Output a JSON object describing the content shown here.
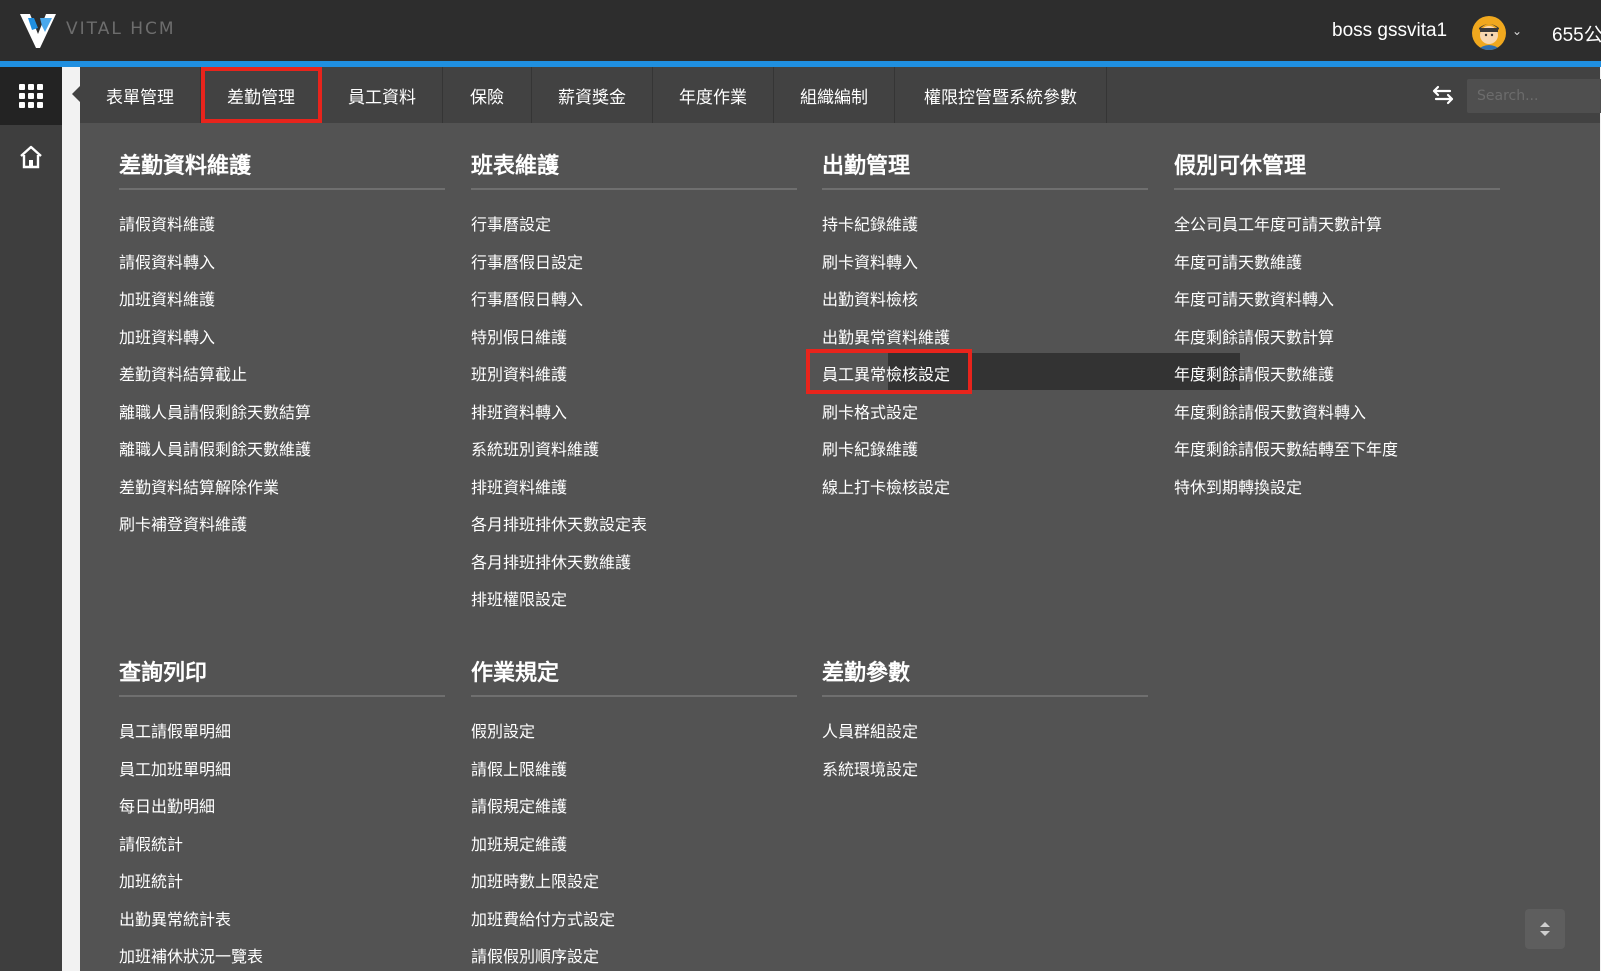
{
  "header": {
    "logo_text": "VITAL HCM",
    "user_name": "boss gssvita1",
    "right_text": "655公"
  },
  "search": {
    "placeholder": "Search..."
  },
  "tabs": [
    "表單管理",
    "差勤管理",
    "員工資料",
    "保險",
    "薪資獎金",
    "年度作業",
    "組織編制",
    "權限控管暨系統參數"
  ],
  "columns": [
    {
      "title": "差勤資料維護",
      "items": [
        "請假資料維護",
        "請假資料轉入",
        "加班資料維護",
        "加班資料轉入",
        "差勤資料結算截止",
        "離職人員請假剩餘天數結算",
        "離職人員請假剩餘天數維護",
        "差勤資料結算解除作業",
        "刷卡補登資料維護"
      ]
    },
    {
      "title": "班表維護",
      "items": [
        "行事曆設定",
        "行事曆假日設定",
        "行事曆假日轉入",
        "特別假日維護",
        "班別資料維護",
        "排班資料轉入",
        "系統班別資料維護",
        "排班資料維護",
        "各月排班排休天數設定表",
        "各月排班排休天數維護",
        "排班權限設定"
      ]
    },
    {
      "title": "出勤管理",
      "items": [
        "持卡紀錄維護",
        "刷卡資料轉入",
        "出勤資料檢核",
        "出勤異常資料維護",
        "員工異常檢核設定",
        "刷卡格式設定",
        "刷卡紀錄維護",
        "線上打卡檢核設定"
      ]
    },
    {
      "title": "假別可休管理",
      "items": [
        "全公司員工年度可請天數計算",
        "年度可請天數維護",
        "年度可請天數資料轉入",
        "年度剩餘請假天數計算",
        "年度剩餘請假天數維護",
        "年度剩餘請假天數資料轉入",
        "年度剩餘請假天數結轉至下年度",
        "特休到期轉換設定"
      ]
    },
    {
      "title": "查詢列印",
      "items": [
        "員工請假單明細",
        "員工加班單明細",
        "每日出勤明細",
        "請假統計",
        "加班統計",
        "出勤異常統計表",
        "加班補休狀況一覽表"
      ]
    },
    {
      "title": "作業規定",
      "items": [
        "假別設定",
        "請假上限維護",
        "請假規定維護",
        "加班規定維護",
        "加班時數上限設定",
        "加班費給付方式設定",
        "請假假別順序設定"
      ]
    },
    {
      "title": "差勤參數",
      "items": [
        "人員群組設定",
        "系統環境設定"
      ]
    }
  ],
  "colors": {
    "header_bg": "#2d2d2d",
    "accent": "#1f8fe0",
    "menu_bg": "#535353",
    "tabbar_bg": "#424242",
    "highlight_red": "#e8241c"
  }
}
